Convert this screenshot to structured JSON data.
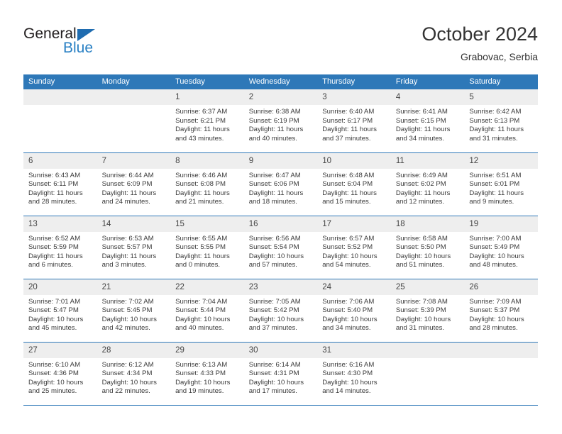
{
  "brand": {
    "word1": "General",
    "word2": "Blue",
    "triangle_color": "#1f6cb0",
    "word2_color": "#2980c4"
  },
  "header": {
    "title": "October 2024",
    "subtitle": "Grabovac, Serbia"
  },
  "theme": {
    "header_blue": "#2e78b8",
    "daynum_gray": "#eeeeee",
    "text": "#3a3a3a"
  },
  "weekdays": [
    "Sunday",
    "Monday",
    "Tuesday",
    "Wednesday",
    "Thursday",
    "Friday",
    "Saturday"
  ],
  "labels": {
    "sunrise_prefix": "Sunrise:",
    "sunset_prefix": "Sunset:",
    "daylight_prefix": "Daylight:"
  },
  "weeks": [
    [
      {
        "day": "",
        "l1": "",
        "l2": "",
        "l3": "",
        "l4": ""
      },
      {
        "day": "",
        "l1": "",
        "l2": "",
        "l3": "",
        "l4": ""
      },
      {
        "day": "1",
        "l1": "Sunrise: 6:37 AM",
        "l2": "Sunset: 6:21 PM",
        "l3": "Daylight: 11 hours",
        "l4": "and 43 minutes."
      },
      {
        "day": "2",
        "l1": "Sunrise: 6:38 AM",
        "l2": "Sunset: 6:19 PM",
        "l3": "Daylight: 11 hours",
        "l4": "and 40 minutes."
      },
      {
        "day": "3",
        "l1": "Sunrise: 6:40 AM",
        "l2": "Sunset: 6:17 PM",
        "l3": "Daylight: 11 hours",
        "l4": "and 37 minutes."
      },
      {
        "day": "4",
        "l1": "Sunrise: 6:41 AM",
        "l2": "Sunset: 6:15 PM",
        "l3": "Daylight: 11 hours",
        "l4": "and 34 minutes."
      },
      {
        "day": "5",
        "l1": "Sunrise: 6:42 AM",
        "l2": "Sunset: 6:13 PM",
        "l3": "Daylight: 11 hours",
        "l4": "and 31 minutes."
      }
    ],
    [
      {
        "day": "6",
        "l1": "Sunrise: 6:43 AM",
        "l2": "Sunset: 6:11 PM",
        "l3": "Daylight: 11 hours",
        "l4": "and 28 minutes."
      },
      {
        "day": "7",
        "l1": "Sunrise: 6:44 AM",
        "l2": "Sunset: 6:09 PM",
        "l3": "Daylight: 11 hours",
        "l4": "and 24 minutes."
      },
      {
        "day": "8",
        "l1": "Sunrise: 6:46 AM",
        "l2": "Sunset: 6:08 PM",
        "l3": "Daylight: 11 hours",
        "l4": "and 21 minutes."
      },
      {
        "day": "9",
        "l1": "Sunrise: 6:47 AM",
        "l2": "Sunset: 6:06 PM",
        "l3": "Daylight: 11 hours",
        "l4": "and 18 minutes."
      },
      {
        "day": "10",
        "l1": "Sunrise: 6:48 AM",
        "l2": "Sunset: 6:04 PM",
        "l3": "Daylight: 11 hours",
        "l4": "and 15 minutes."
      },
      {
        "day": "11",
        "l1": "Sunrise: 6:49 AM",
        "l2": "Sunset: 6:02 PM",
        "l3": "Daylight: 11 hours",
        "l4": "and 12 minutes."
      },
      {
        "day": "12",
        "l1": "Sunrise: 6:51 AM",
        "l2": "Sunset: 6:01 PM",
        "l3": "Daylight: 11 hours",
        "l4": "and 9 minutes."
      }
    ],
    [
      {
        "day": "13",
        "l1": "Sunrise: 6:52 AM",
        "l2": "Sunset: 5:59 PM",
        "l3": "Daylight: 11 hours",
        "l4": "and 6 minutes."
      },
      {
        "day": "14",
        "l1": "Sunrise: 6:53 AM",
        "l2": "Sunset: 5:57 PM",
        "l3": "Daylight: 11 hours",
        "l4": "and 3 minutes."
      },
      {
        "day": "15",
        "l1": "Sunrise: 6:55 AM",
        "l2": "Sunset: 5:55 PM",
        "l3": "Daylight: 11 hours",
        "l4": "and 0 minutes."
      },
      {
        "day": "16",
        "l1": "Sunrise: 6:56 AM",
        "l2": "Sunset: 5:54 PM",
        "l3": "Daylight: 10 hours",
        "l4": "and 57 minutes."
      },
      {
        "day": "17",
        "l1": "Sunrise: 6:57 AM",
        "l2": "Sunset: 5:52 PM",
        "l3": "Daylight: 10 hours",
        "l4": "and 54 minutes."
      },
      {
        "day": "18",
        "l1": "Sunrise: 6:58 AM",
        "l2": "Sunset: 5:50 PM",
        "l3": "Daylight: 10 hours",
        "l4": "and 51 minutes."
      },
      {
        "day": "19",
        "l1": "Sunrise: 7:00 AM",
        "l2": "Sunset: 5:49 PM",
        "l3": "Daylight: 10 hours",
        "l4": "and 48 minutes."
      }
    ],
    [
      {
        "day": "20",
        "l1": "Sunrise: 7:01 AM",
        "l2": "Sunset: 5:47 PM",
        "l3": "Daylight: 10 hours",
        "l4": "and 45 minutes."
      },
      {
        "day": "21",
        "l1": "Sunrise: 7:02 AM",
        "l2": "Sunset: 5:45 PM",
        "l3": "Daylight: 10 hours",
        "l4": "and 42 minutes."
      },
      {
        "day": "22",
        "l1": "Sunrise: 7:04 AM",
        "l2": "Sunset: 5:44 PM",
        "l3": "Daylight: 10 hours",
        "l4": "and 40 minutes."
      },
      {
        "day": "23",
        "l1": "Sunrise: 7:05 AM",
        "l2": "Sunset: 5:42 PM",
        "l3": "Daylight: 10 hours",
        "l4": "and 37 minutes."
      },
      {
        "day": "24",
        "l1": "Sunrise: 7:06 AM",
        "l2": "Sunset: 5:40 PM",
        "l3": "Daylight: 10 hours",
        "l4": "and 34 minutes."
      },
      {
        "day": "25",
        "l1": "Sunrise: 7:08 AM",
        "l2": "Sunset: 5:39 PM",
        "l3": "Daylight: 10 hours",
        "l4": "and 31 minutes."
      },
      {
        "day": "26",
        "l1": "Sunrise: 7:09 AM",
        "l2": "Sunset: 5:37 PM",
        "l3": "Daylight: 10 hours",
        "l4": "and 28 minutes."
      }
    ],
    [
      {
        "day": "27",
        "l1": "Sunrise: 6:10 AM",
        "l2": "Sunset: 4:36 PM",
        "l3": "Daylight: 10 hours",
        "l4": "and 25 minutes."
      },
      {
        "day": "28",
        "l1": "Sunrise: 6:12 AM",
        "l2": "Sunset: 4:34 PM",
        "l3": "Daylight: 10 hours",
        "l4": "and 22 minutes."
      },
      {
        "day": "29",
        "l1": "Sunrise: 6:13 AM",
        "l2": "Sunset: 4:33 PM",
        "l3": "Daylight: 10 hours",
        "l4": "and 19 minutes."
      },
      {
        "day": "30",
        "l1": "Sunrise: 6:14 AM",
        "l2": "Sunset: 4:31 PM",
        "l3": "Daylight: 10 hours",
        "l4": "and 17 minutes."
      },
      {
        "day": "31",
        "l1": "Sunrise: 6:16 AM",
        "l2": "Sunset: 4:30 PM",
        "l3": "Daylight: 10 hours",
        "l4": "and 14 minutes."
      },
      {
        "day": "",
        "l1": "",
        "l2": "",
        "l3": "",
        "l4": ""
      },
      {
        "day": "",
        "l1": "",
        "l2": "",
        "l3": "",
        "l4": ""
      }
    ]
  ]
}
